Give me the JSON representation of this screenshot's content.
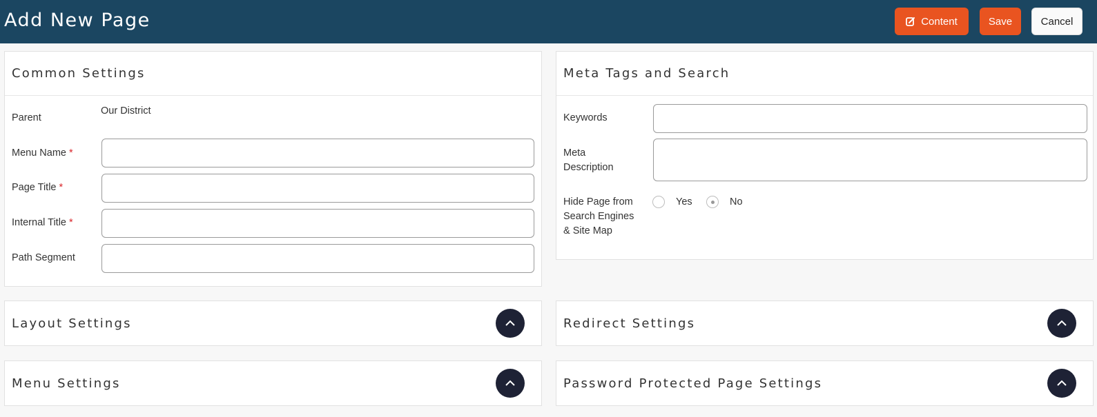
{
  "header": {
    "title": "Add New Page",
    "content_label": "Content",
    "save_label": "Save",
    "cancel_label": "Cancel",
    "accent_color": "#e95420",
    "bar_color": "#1b4661"
  },
  "common": {
    "title": "Common Settings",
    "parent_label": "Parent",
    "parent_value": "Our District",
    "menu_name_label": "Menu Name",
    "page_title_label": "Page Title",
    "internal_title_label": "Internal Title",
    "path_segment_label": "Path Segment",
    "required_mark": "*",
    "menu_name_value": "",
    "page_title_value": "",
    "internal_title_value": "",
    "path_segment_value": ""
  },
  "meta": {
    "title": "Meta Tags and Search",
    "keywords_label": "Keywords",
    "description_label_1": "Meta",
    "description_label_2": "Description",
    "hide_label_1": "Hide Page from",
    "hide_label_2": "Search Engines",
    "hide_label_3": "& Site Map",
    "yes_label": "Yes",
    "no_label": "No",
    "selected": "No",
    "keywords_value": "",
    "description_value": ""
  },
  "sections": {
    "layout": "Layout Settings",
    "redirect": "Redirect Settings",
    "menu": "Menu Settings",
    "password": "Password Protected Page Settings"
  },
  "icons": {
    "content": "edit-icon",
    "toggle": "chevron-up-icon"
  }
}
